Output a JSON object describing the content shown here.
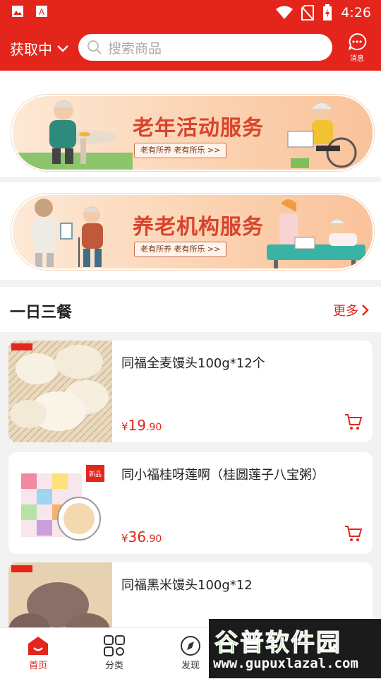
{
  "status": {
    "time": "4:26"
  },
  "header": {
    "location": "获取中",
    "search_placeholder": "搜索商品",
    "message_label": "消息"
  },
  "banners": [
    {
      "title": "老年活动服务",
      "tagline": "老有所养  老有所乐  >>"
    },
    {
      "title": "养老机构服务",
      "tagline": "老有所养  老有所乐  >>"
    }
  ],
  "section": {
    "title": "一日三餐",
    "more": "更多"
  },
  "products": [
    {
      "name": "同福全麦馒头100g*12个",
      "price_symbol": "¥",
      "price_int": "19",
      "price_dec": ".90",
      "image": "steamed-buns"
    },
    {
      "name": "同小福桂呀莲啊（桂圆莲子八宝粥）",
      "price_symbol": "¥",
      "price_int": "36",
      "price_dec": ".90",
      "image": "porridge-gift-box",
      "badge": "新品"
    },
    {
      "name": "同福黑米馒头100g*12",
      "image": "black-rice-buns"
    }
  ],
  "nav": [
    {
      "label": "首页",
      "icon": "home-icon",
      "active": true
    },
    {
      "label": "分类",
      "icon": "category-icon",
      "active": false
    },
    {
      "label": "发现",
      "icon": "compass-icon",
      "active": false
    }
  ],
  "watermark": {
    "title": "谷普软件园",
    "url": "www.gupuxlazal.com"
  },
  "colors": {
    "brand": "#e4251c",
    "background": "#f2f2f2"
  }
}
